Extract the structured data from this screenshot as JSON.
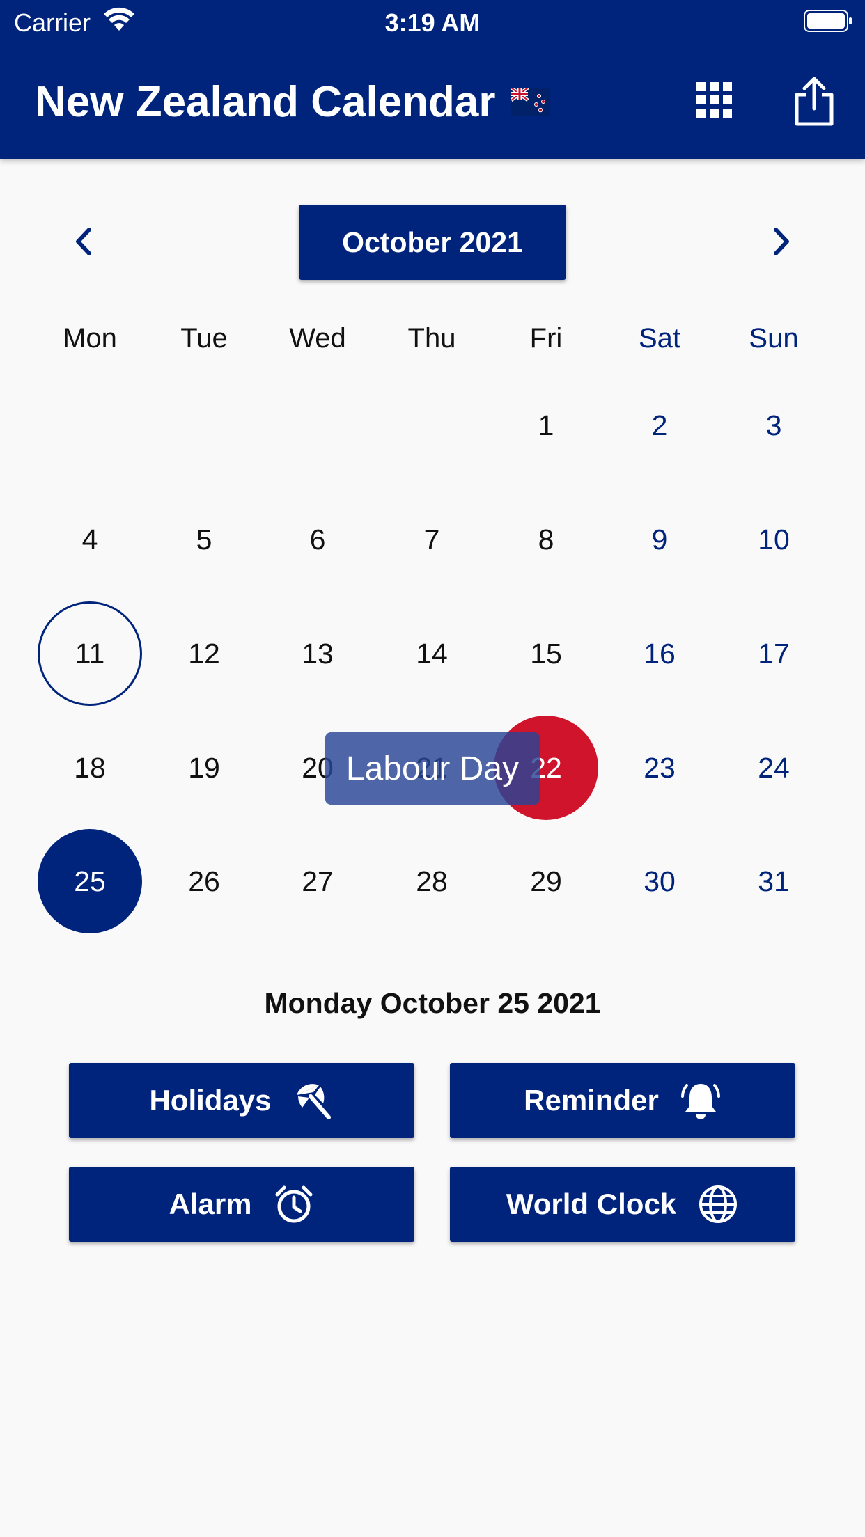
{
  "status_bar": {
    "carrier": "Carrier",
    "time": "3:19 AM"
  },
  "header": {
    "title": "New Zealand Calendar",
    "icons": [
      "flag-nz-icon",
      "grid-icon",
      "share-icon"
    ]
  },
  "calendar": {
    "month_label": "October 2021",
    "weekdays": [
      "Mon",
      "Tue",
      "Wed",
      "Thu",
      "Fri",
      "Sat",
      "Sun"
    ],
    "first_weekday_index": 4,
    "days_in_month": 31,
    "today": 11,
    "selected": 25,
    "holiday_day": 22,
    "holiday_tooltip": "Labour Day",
    "weekend_color": "#00237c",
    "holiday_color": "#d0142c"
  },
  "selected_date_label": "Monday October 25 2021",
  "actions": {
    "holidays": "Holidays",
    "reminder": "Reminder",
    "alarm": "Alarm",
    "world_clock": "World Clock"
  },
  "colors": {
    "primary": "#00237c",
    "background": "#f9f9fa"
  }
}
